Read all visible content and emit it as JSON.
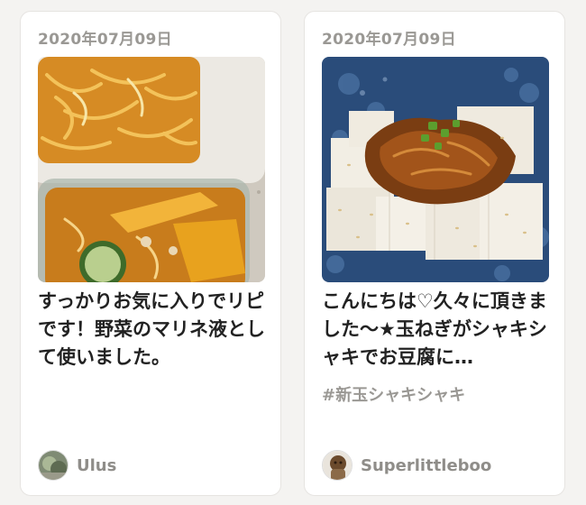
{
  "cards": [
    {
      "date": "2020年07月09日",
      "photo_icon": "marinated-vegetables-photo",
      "description": "すっかりお気に入りでリピです！野菜のマリネ液として使いました。",
      "hashtag": "",
      "username": "Ulus",
      "avatar_icon": "user-avatar-photo"
    },
    {
      "date": "2020年07月09日",
      "photo_icon": "tofu-with-onion-photo",
      "description": "こんにちは♡久々に頂きました〜★玉ねぎがシャキシャキでお豆腐に…",
      "hashtag": "#新玉シャキシャキ",
      "username": "Superlittleboo",
      "avatar_icon": "user-avatar-photo"
    }
  ],
  "colors": {
    "background": "#f4f3f1",
    "card": "#ffffff",
    "meta_text": "#9a9894",
    "body_text": "#222222"
  }
}
